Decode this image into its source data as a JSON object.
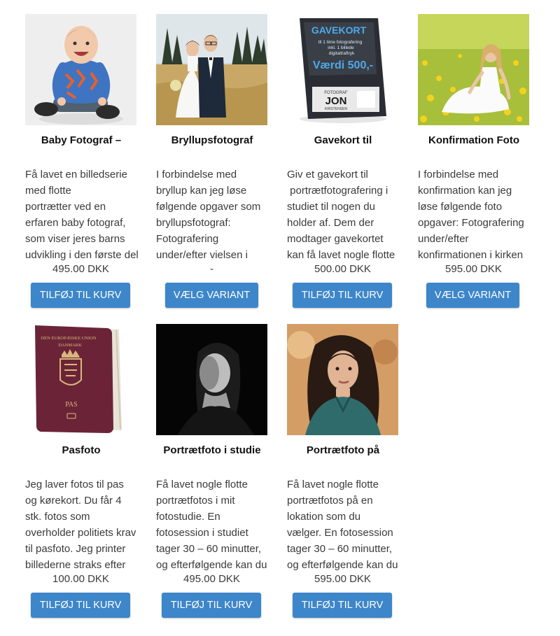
{
  "products": [
    {
      "title": "Baby Fotograf –",
      "desc": [
        "Få lavet en billedserie",
        "med flotte",
        "portrætter ved en",
        "erfaren baby fotograf,",
        "som viser jeres barns",
        "udvikling i den første del"
      ],
      "price": "495.00 DKK",
      "button": "TILFØJ TIL KURV"
    },
    {
      "title": "Bryllupsfotograf",
      "desc": [
        "I forbindelse med",
        "bryllup kan jeg løse",
        "følgende opgaver som",
        "bryllupsfotograf:",
        "Fotografering",
        "under/efter vielsen i"
      ],
      "price": "-",
      "button": "VÆLG VARIANT"
    },
    {
      "title": "Gavekort til",
      "desc": [
        "Giv et gavekort til",
        " portrætfotografering i",
        "studiet til nogen du",
        "holder af. Dem der",
        "modtager gavekortet",
        "kan få lavet nogle flotte"
      ],
      "price": "500.00 DKK",
      "button": "TILFØJ TIL KURV",
      "card_text": {
        "heading": "GAVEKORT",
        "line1": "til 1 time fotografering",
        "line2": "inkl. 1 billede",
        "line3": "digitalt/aftryk",
        "value": "Værdi 500,-",
        "brand_top": "FOTOGRAF",
        "brand": "JON",
        "brand_bottom": "KRISTENSEN"
      }
    },
    {
      "title": "Konfirmation Foto",
      "desc": [
        "I forbindelse med",
        "konfirmation kan jeg",
        "løse følgende foto",
        "opgaver: Fotografering",
        "under/efter",
        "konfirmationen i kirken"
      ],
      "price": "595.00 DKK",
      "button": "VÆLG VARIANT"
    },
    {
      "title": "Pasfoto",
      "desc": [
        "Jeg laver fotos til pas",
        "og kørekort. Du får 4",
        "stk. fotos som",
        "overholder politiets krav",
        "til pasfoto. Jeg printer",
        "billederne straks efter"
      ],
      "price": "100.00 DKK",
      "button": "TILFØJ TIL KURV",
      "passport_text": {
        "top": "DEN EUROPÆISKE UNION",
        "country": "DANMARK",
        "label": "PAS"
      }
    },
    {
      "title": "Portrætfoto i studie",
      "desc": [
        "Få lavet nogle flotte",
        "portrætfotos i mit",
        "fotostudie. En",
        "fotosession i studiet",
        "tager 30 – 60 minutter,",
        "og efterfølgende kan du"
      ],
      "price": "495.00 DKK",
      "button": "TILFØJ TIL KURV"
    },
    {
      "title": "Portrætfoto på",
      "desc": [
        "Få lavet nogle flotte",
        "portrætfotos på en",
        "lokation som du",
        "vælger. En fotosession",
        "tager 30 – 60 minutter,",
        "og efterfølgende kan du"
      ],
      "price": "595.00 DKK",
      "button": "TILFØJ TIL KURV"
    }
  ],
  "colors": {
    "button": "#3d86c9",
    "button_text": "#ffffff",
    "title": "#111111",
    "text": "#3a3a3a"
  }
}
